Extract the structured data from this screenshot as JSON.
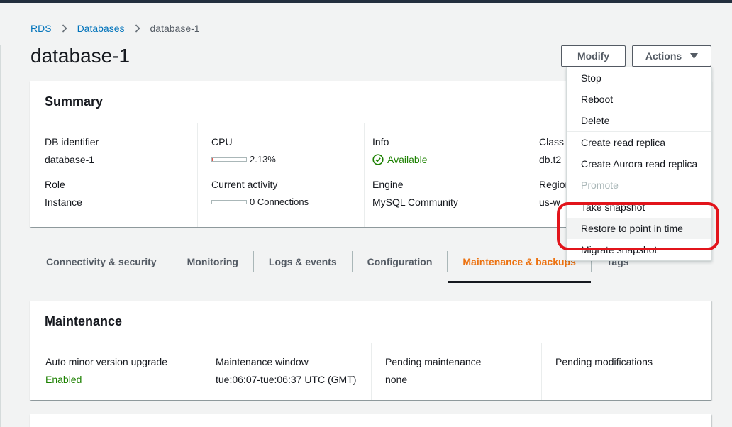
{
  "breadcrumb": {
    "items": [
      "RDS",
      "Databases"
    ],
    "current": "database-1"
  },
  "page": {
    "title": "database-1"
  },
  "actions": {
    "modify_label": "Modify",
    "actions_label": "Actions"
  },
  "summary": {
    "title": "Summary",
    "db_identifier": {
      "label": "DB identifier",
      "value": "database-1"
    },
    "role": {
      "label": "Role",
      "value": "Instance"
    },
    "cpu": {
      "label": "CPU",
      "value": "2.13%",
      "fraction": 0.0213
    },
    "current_activity": {
      "label": "Current activity",
      "value": "0 Connections",
      "fraction": 0
    },
    "info": {
      "label": "Info",
      "value": "Available"
    },
    "engine": {
      "label": "Engine",
      "value": "MySQL Community"
    },
    "class": {
      "label": "Class",
      "value": "db.t2"
    },
    "region": {
      "label": "Region",
      "value": "us-w"
    }
  },
  "tabs": [
    {
      "label": "Connectivity & security"
    },
    {
      "label": "Monitoring"
    },
    {
      "label": "Logs & events"
    },
    {
      "label": "Configuration"
    },
    {
      "label": "Maintenance & backups"
    },
    {
      "label": "Tags"
    }
  ],
  "maintenance": {
    "title": "Maintenance",
    "auto_minor": {
      "label": "Auto minor version upgrade",
      "value": "Enabled"
    },
    "window": {
      "label": "Maintenance window",
      "value": "tue:06:07-tue:06:37 UTC (GMT)"
    },
    "pending": {
      "label": "Pending maintenance",
      "value": "none"
    },
    "modifications": {
      "label": "Pending modifications",
      "value": ""
    }
  },
  "actions_menu": {
    "items": [
      {
        "label": "Stop"
      },
      {
        "label": "Reboot"
      },
      {
        "label": "Delete"
      },
      {
        "label": "Create read replica"
      },
      {
        "label": "Create Aurora read replica"
      },
      {
        "label": "Promote"
      },
      {
        "label": "Take snapshot"
      },
      {
        "label": "Restore to point in time"
      },
      {
        "label": "Migrate snapshot"
      }
    ]
  },
  "colors": {
    "link": "#0073bb",
    "active_tab": "#ec7211",
    "success": "#1d8102",
    "highlight": "#e2141b"
  }
}
